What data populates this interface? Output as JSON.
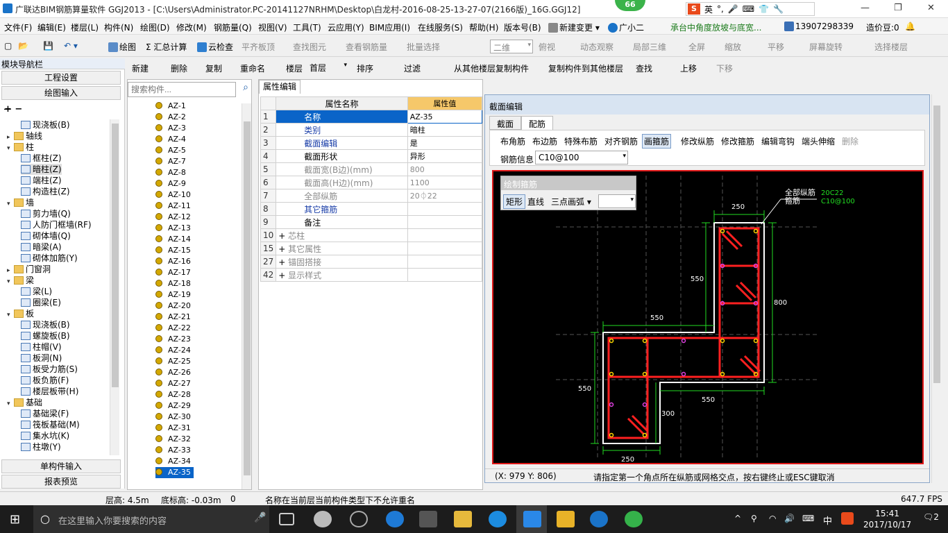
{
  "app": {
    "title": "广联达BIM钢筋算量软件 GGJ2013 - [C:\\Users\\Administrator.PC-20141127NRHM\\Desktop\\白龙村-2016-08-25-13-27-07(2166版)_16G.GGJ12]",
    "badge": "66",
    "ime_label": "英",
    "win_min": "—",
    "win_max": "❐",
    "win_close": "✕"
  },
  "menu": {
    "items": [
      "文件(F)",
      "编辑(E)",
      "楼层(L)",
      "构件(N)",
      "绘图(D)",
      "修改(M)",
      "钢筋量(Q)",
      "视图(V)",
      "工具(T)",
      "云应用(Y)",
      "BIM应用(I)",
      "在线服务(S)",
      "帮助(H)",
      "版本号(B)"
    ],
    "new_change": "新建变更 ▾",
    "xiaoer": "广小二",
    "promo": "承台中角度放坡与底宽...",
    "phone": "13907298339",
    "cost_beans": "造价豆:0"
  },
  "toolbar1": {
    "draw": "绘图",
    "sum": "Σ 汇总计算",
    "cloud_check": "云检查",
    "flush": "平齐板顶",
    "find_elem": "查找图元",
    "view_rebar": "查看钢筋量",
    "batch": "批量选择",
    "view2d": "二维",
    "top_view": "俯视",
    "dyn_view": "动态观察",
    "local3d": "局部三维",
    "fullscreen": "全屏",
    "zoom": "缩放",
    "pan": "平移",
    "rotate": "屏幕旋转",
    "select_floor": "选择楼层"
  },
  "toolbar2": {
    "new": "新建",
    "delete": "删除",
    "copy": "复制",
    "rename": "重命名",
    "floor_label": "楼层",
    "floor_value": "首层",
    "sort": "排序",
    "filter": "过滤",
    "copy_from": "从其他楼层复制构件",
    "copy_to": "复制构件到其他楼层",
    "find": "查找",
    "up": "上移",
    "down": "下移"
  },
  "nav": {
    "header": "模块导航栏",
    "project_settings": "工程设置",
    "draw_input": "绘图输入",
    "single_input": "单构件输入",
    "report_preview": "报表预览",
    "tree": [
      {
        "label": "现浇板(B)",
        "level": 2,
        "type": "leaf"
      },
      {
        "label": "轴线",
        "level": 1,
        "type": "folder",
        "toggle": "▸"
      },
      {
        "label": "柱",
        "level": 1,
        "type": "folder",
        "toggle": "▾"
      },
      {
        "label": "框柱(Z)",
        "level": 2,
        "type": "leaf"
      },
      {
        "label": "暗柱(Z)",
        "level": 2,
        "type": "leaf",
        "selected": true
      },
      {
        "label": "端柱(Z)",
        "level": 2,
        "type": "leaf"
      },
      {
        "label": "构造柱(Z)",
        "level": 2,
        "type": "leaf"
      },
      {
        "label": "墙",
        "level": 1,
        "type": "folder",
        "toggle": "▾"
      },
      {
        "label": "剪力墙(Q)",
        "level": 2,
        "type": "leaf"
      },
      {
        "label": "人防门框墙(RF)",
        "level": 2,
        "type": "leaf"
      },
      {
        "label": "砌体墙(Q)",
        "level": 2,
        "type": "leaf"
      },
      {
        "label": "暗梁(A)",
        "level": 2,
        "type": "leaf"
      },
      {
        "label": "砌体加筋(Y)",
        "level": 2,
        "type": "leaf"
      },
      {
        "label": "门窗洞",
        "level": 1,
        "type": "folder",
        "toggle": "▸"
      },
      {
        "label": "梁",
        "level": 1,
        "type": "folder",
        "toggle": "▾"
      },
      {
        "label": "梁(L)",
        "level": 2,
        "type": "leaf"
      },
      {
        "label": "圈梁(E)",
        "level": 2,
        "type": "leaf"
      },
      {
        "label": "板",
        "level": 1,
        "type": "folder",
        "toggle": "▾"
      },
      {
        "label": "现浇板(B)",
        "level": 2,
        "type": "leaf"
      },
      {
        "label": "螺旋板(B)",
        "level": 2,
        "type": "leaf"
      },
      {
        "label": "柱帽(V)",
        "level": 2,
        "type": "leaf"
      },
      {
        "label": "板洞(N)",
        "level": 2,
        "type": "leaf"
      },
      {
        "label": "板受力筋(S)",
        "level": 2,
        "type": "leaf"
      },
      {
        "label": "板负筋(F)",
        "level": 2,
        "type": "leaf"
      },
      {
        "label": "楼层板带(H)",
        "level": 2,
        "type": "leaf"
      },
      {
        "label": "基础",
        "level": 1,
        "type": "folder",
        "toggle": "▾"
      },
      {
        "label": "基础梁(F)",
        "level": 2,
        "type": "leaf"
      },
      {
        "label": "筏板基础(M)",
        "level": 2,
        "type": "leaf"
      },
      {
        "label": "集水坑(K)",
        "level": 2,
        "type": "leaf"
      },
      {
        "label": "柱墩(Y)",
        "level": 2,
        "type": "leaf"
      }
    ]
  },
  "components": {
    "search_placeholder": "搜索构件...",
    "items": [
      "AZ-1",
      "AZ-2",
      "AZ-3",
      "AZ-4",
      "AZ-5",
      "AZ-7",
      "AZ-8",
      "AZ-9",
      "AZ-10",
      "AZ-11",
      "AZ-12",
      "AZ-13",
      "AZ-14",
      "AZ-15",
      "AZ-16",
      "AZ-17",
      "AZ-18",
      "AZ-19",
      "AZ-20",
      "AZ-21",
      "AZ-22",
      "AZ-23",
      "AZ-24",
      "AZ-25",
      "AZ-26",
      "AZ-27",
      "AZ-28",
      "AZ-29",
      "AZ-30",
      "AZ-31",
      "AZ-32",
      "AZ-33",
      "AZ-34",
      "AZ-35"
    ],
    "selected": "AZ-35"
  },
  "props": {
    "tab": "属性编辑",
    "col_name": "属性名称",
    "col_value": "属性值",
    "rows": [
      {
        "n": "1",
        "k": "名称",
        "v": "AZ-35",
        "style": "blue"
      },
      {
        "n": "2",
        "k": "类别",
        "v": "暗柱",
        "style": "blue"
      },
      {
        "n": "3",
        "k": "截面编辑",
        "v": "是",
        "style": "blue"
      },
      {
        "n": "4",
        "k": "截面形状",
        "v": "异形",
        "style": "normal"
      },
      {
        "n": "5",
        "k": "截面宽(B边)(mm)",
        "v": "800",
        "style": "gray"
      },
      {
        "n": "6",
        "k": "截面高(H边)(mm)",
        "v": "1100",
        "style": "gray"
      },
      {
        "n": "7",
        "k": "全部纵筋",
        "v": "20⏀22",
        "style": "gray"
      },
      {
        "n": "8",
        "k": "其它箍筋",
        "v": "",
        "style": "blue"
      },
      {
        "n": "9",
        "k": "备注",
        "v": "",
        "style": "normal"
      },
      {
        "n": "10",
        "k": "芯柱",
        "v": "",
        "style": "gray",
        "plus": true
      },
      {
        "n": "15",
        "k": "其它属性",
        "v": "",
        "style": "gray",
        "plus": true
      },
      {
        "n": "27",
        "k": "锚固搭接",
        "v": "",
        "style": "gray",
        "plus": true
      },
      {
        "n": "42",
        "k": "显示样式",
        "v": "",
        "style": "gray",
        "plus": true
      }
    ]
  },
  "section": {
    "title": "截面编辑",
    "tab_section": "截面",
    "tab_rebar": "配筋",
    "tools": [
      "布角筋",
      "布边筋",
      "特殊布筋",
      "对齐钢筋",
      "画箍筋",
      "修改纵筋",
      "修改箍筋",
      "编辑弯钩",
      "端头伸缩",
      "删除"
    ],
    "rebar_info_label": "钢筋信息",
    "rebar_info_value": "C10@100",
    "draw_panel_title": "绘制箍筋",
    "draw_rect": "矩形",
    "draw_line": "直线",
    "draw_arc": "三点画弧",
    "coords": "(X: 979 Y: 806)",
    "hint": "请指定第一个角点所在纵筋或网格交点，按右键终止或ESC键取消",
    "legend_long": "全部纵筋",
    "legend_hoop": "箍筋",
    "legend_long_val": "20C22",
    "legend_hoop_val": "C10@100",
    "dims": {
      "top": "250",
      "top_left": "550",
      "right": "800",
      "mid_left": "550",
      "left": "550",
      "bottom_right": "550",
      "bottom_inner": "300",
      "bottom": "250"
    }
  },
  "status": {
    "floor_height": "层高: 4.5m",
    "base_height": "底标高: -0.03m",
    "zero": "0",
    "message": "名称在当前层当前构件类型下不允许重名",
    "fps": "647.7 FPS"
  },
  "taskbar": {
    "search_placeholder": "在这里输入你要搜索的内容",
    "time": "15:41",
    "date": "2017/10/17",
    "lang": "中",
    "notif": "2"
  },
  "colors": {
    "accent": "#0a64c8",
    "canvas_border": "#e01818",
    "rebar_red": "#ff2020",
    "dim_green": "#22dd22"
  }
}
